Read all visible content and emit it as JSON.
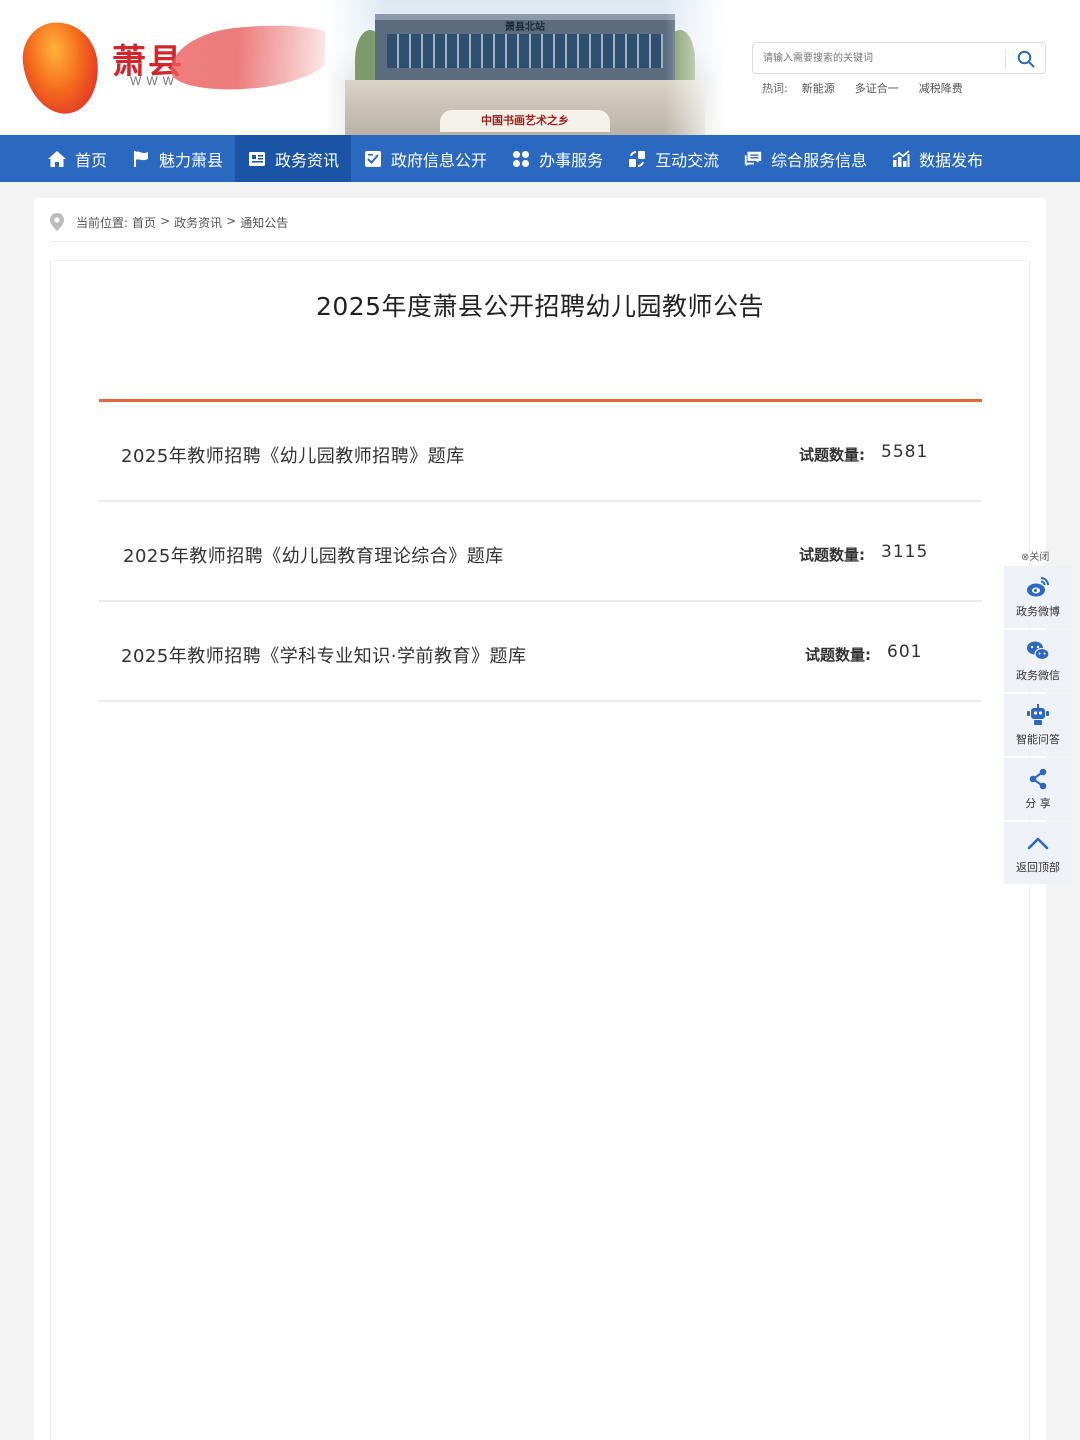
{
  "header": {
    "logo_text": "萧县",
    "logo_sub": "WWW",
    "banner_station_name": "萧县北站",
    "banner_plaque": "中国书画艺术之乡"
  },
  "search": {
    "placeholder": "请输入需要搜索的关键词",
    "hot_label": "热词:",
    "hot_words": [
      "新能源",
      "多证合一",
      "减税降费"
    ]
  },
  "nav": {
    "items": [
      {
        "label": "首页",
        "icon": "home-icon"
      },
      {
        "label": "魅力萧县",
        "icon": "flag-icon"
      },
      {
        "label": "政务资讯",
        "icon": "news-icon"
      },
      {
        "label": "政府信息公开",
        "icon": "document-check-icon"
      },
      {
        "label": "办事服务",
        "icon": "grid-icon"
      },
      {
        "label": "互动交流",
        "icon": "exchange-icon"
      },
      {
        "label": "综合服务信息",
        "icon": "message-icon"
      },
      {
        "label": "数据发布",
        "icon": "chart-icon"
      }
    ],
    "active_index": 2
  },
  "breadcrumb": {
    "prefix": "当前位置:",
    "items": [
      "首页",
      "政务资讯",
      "通知公告"
    ],
    "separator": ">"
  },
  "article": {
    "title": "2025年度萧县公开招聘幼儿园教师公告",
    "count_label": "试题数量:",
    "banks": [
      {
        "name": "2025年教师招聘《幼儿园教师招聘》题库",
        "count": "5581"
      },
      {
        "name": "2025年教师招聘《幼儿园教育理论综合》题库",
        "count": "3115"
      },
      {
        "name": "2025年教师招聘《学科专业知识·学前教育》题库",
        "count": "601"
      }
    ]
  },
  "side_panel": {
    "close_label": "⊗关闭",
    "items": [
      {
        "label": "政务微博",
        "icon": "weibo-icon"
      },
      {
        "label": "政务微信",
        "icon": "wechat-icon"
      },
      {
        "label": "智能问答",
        "icon": "robot-icon"
      },
      {
        "label": "分 享",
        "icon": "share-icon"
      },
      {
        "label": "返回顶部",
        "icon": "chevron-up-icon"
      }
    ]
  },
  "colors": {
    "nav_bg": "#2a69bf",
    "nav_active": "#1b54a4",
    "accent_rule": "#e2673a",
    "side_icon": "#2a69bf"
  }
}
